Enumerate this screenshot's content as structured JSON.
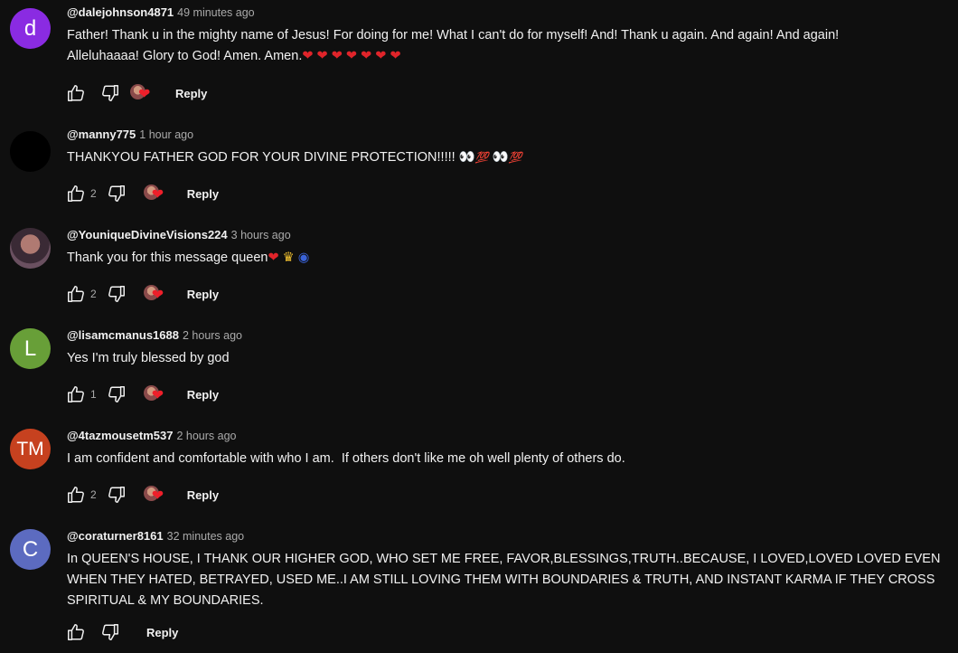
{
  "comments": [
    {
      "avatar_letter": "d",
      "avatar_color": "#8a2be2",
      "author": "@dalejohnson4871",
      "time": "49 minutes ago",
      "line1": "Father! Thank u in the mighty name of Jesus! For doing for me! What I can't do for myself! And! Thank u again. And again! And again!",
      "line2": "Alleluhaaaa! Glory to God! Amen. Amen.",
      "like_count": "",
      "reply_label": "Reply"
    },
    {
      "avatar_letter": "",
      "avatar_color": "#000000",
      "author": "@manny775",
      "time": "1 hour ago",
      "text": "THANKYOU FATHER GOD FOR YOUR DIVINE PROTECTION!!!!!",
      "like_count": "2",
      "reply_label": "Reply"
    },
    {
      "avatar_letter": "",
      "avatar_color": "#5a3f55",
      "author": "@YouniqueDivineVisions224",
      "time": "3 hours ago",
      "text": "Thank you for this message queen",
      "like_count": "2",
      "reply_label": "Reply"
    },
    {
      "avatar_letter": "L",
      "avatar_color": "#689f38",
      "author": "@lisamcmanus1688",
      "time": "2 hours ago",
      "text": "Yes I'm truly blessed by god",
      "like_count": "1",
      "reply_label": "Reply"
    },
    {
      "avatar_letter": "TM",
      "avatar_color": "#c6411f",
      "author": "@4tazmousetm537",
      "time": "2 hours ago",
      "text": "I am confident and comfortable with who I am.  If others don't like me oh well plenty of others do.",
      "like_count": "2",
      "reply_label": "Reply"
    },
    {
      "avatar_letter": "C",
      "avatar_color": "#5c6bc0",
      "author": "@coraturner8161",
      "time": "32 minutes ago",
      "line1": "In QUEEN'S  HOUSE, I THANK OUR HIGHER GOD, WHO SET ME FREE, FAVOR,BLESSINGS,TRUTH..BECAUSE, I LOVED,LOVED LOVED EVEN",
      "line2": "WHEN THEY HATED, BETRAYED, USED ME..I AM STILL LOVING THEM WITH BOUNDARIES & TRUTH, AND INSTANT KARMA IF THEY CROSS",
      "line3": "SPIRITUAL & MY BOUNDARIES.",
      "like_count": "",
      "reply_label": "Reply"
    }
  ],
  "emoji": {
    "heart": "❤",
    "eyes": "👀",
    "hundred": "💯",
    "crown": "♛",
    "nazar": "◉"
  }
}
